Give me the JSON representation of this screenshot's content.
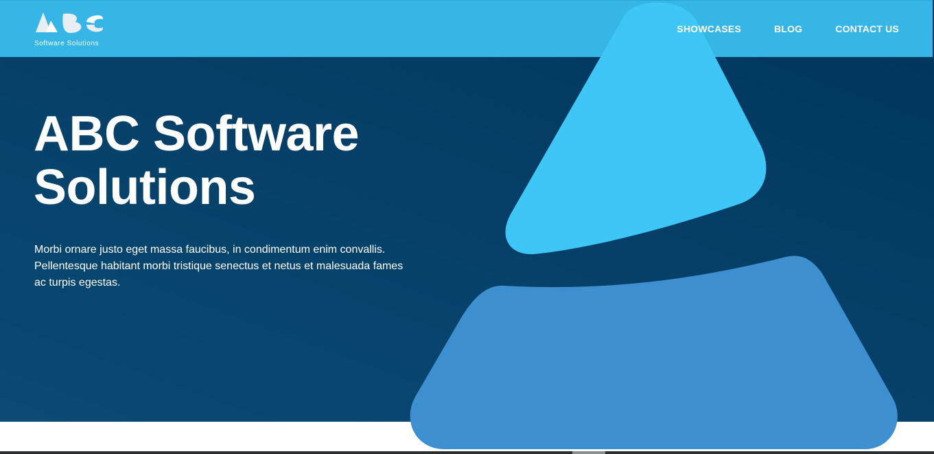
{
  "header": {
    "logo": {
      "mark": "ABC",
      "tagline": "Software Solutions"
    },
    "nav": [
      {
        "label": "SHOWCASES"
      },
      {
        "label": "BLOG"
      },
      {
        "label": "CONTACT US"
      }
    ]
  },
  "hero": {
    "title": "ABC Software Solutions",
    "description": "Morbi ornare justo eget massa faucibus, in condimentum enim convallis. Pellentesque habitant morbi tristique senectus et netus et malesuada fames ac turpis egestas."
  },
  "colors": {
    "header_bg": "#36b6e6",
    "hero_bg": "#063f67",
    "shape_light": "#3ec6f6",
    "shape_mid": "#3e8fcf",
    "text": "#ffffff"
  }
}
